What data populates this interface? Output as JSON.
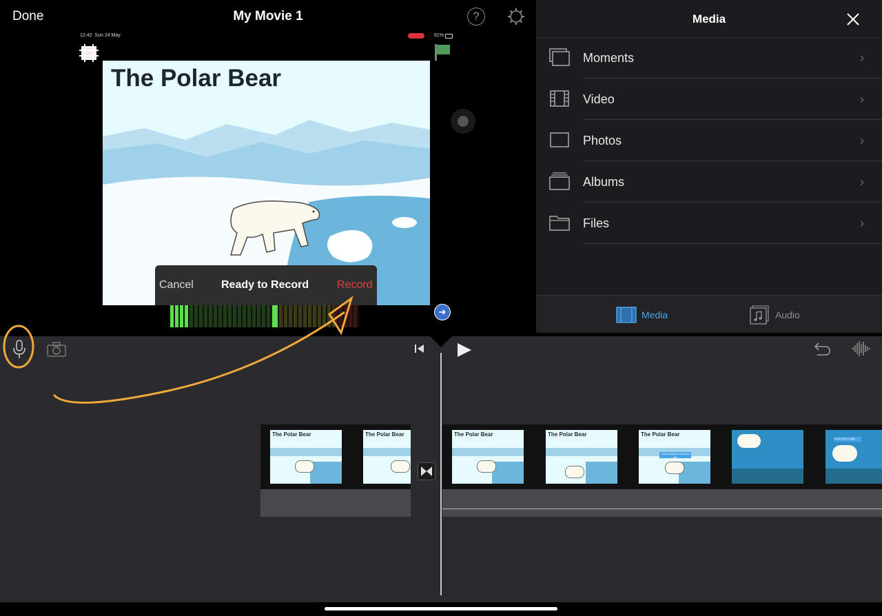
{
  "topbar": {
    "done": "Done",
    "title": "My Movie 1",
    "help": "?"
  },
  "status": {
    "time": "12:42",
    "date": "Sun 24 May",
    "battery": "61%"
  },
  "slide": {
    "title": "The Polar Bear"
  },
  "record_popup": {
    "cancel": "Cancel",
    "status": "Ready to Record",
    "record": "Record"
  },
  "media_panel": {
    "title": "Media",
    "items": [
      {
        "label": "Moments",
        "icon": "moments-icon"
      },
      {
        "label": "Video",
        "icon": "film-icon"
      },
      {
        "label": "Photos",
        "icon": "photo-icon"
      },
      {
        "label": "Albums",
        "icon": "albums-icon"
      },
      {
        "label": "Files",
        "icon": "folder-icon"
      }
    ],
    "tabs": [
      {
        "label": "Media",
        "active": true
      },
      {
        "label": "Audio",
        "active": false
      }
    ]
  },
  "timeline": {
    "clips": [
      {
        "title": "The Polar Bear"
      },
      {
        "title": "The Polar Bear"
      },
      {
        "title": "The Polar Bear"
      },
      {
        "title": "The Polar Bear"
      },
      {
        "title": "The Polar Bear"
      },
      {
        "caption": "I am looking for food to eat."
      },
      {
        "caption": "I can't see a crab."
      }
    ]
  },
  "colors": {
    "accent": "#4aa3e8",
    "record": "#e2423a",
    "annotation": "#f0a93a",
    "meter_green": "#5be04a"
  }
}
